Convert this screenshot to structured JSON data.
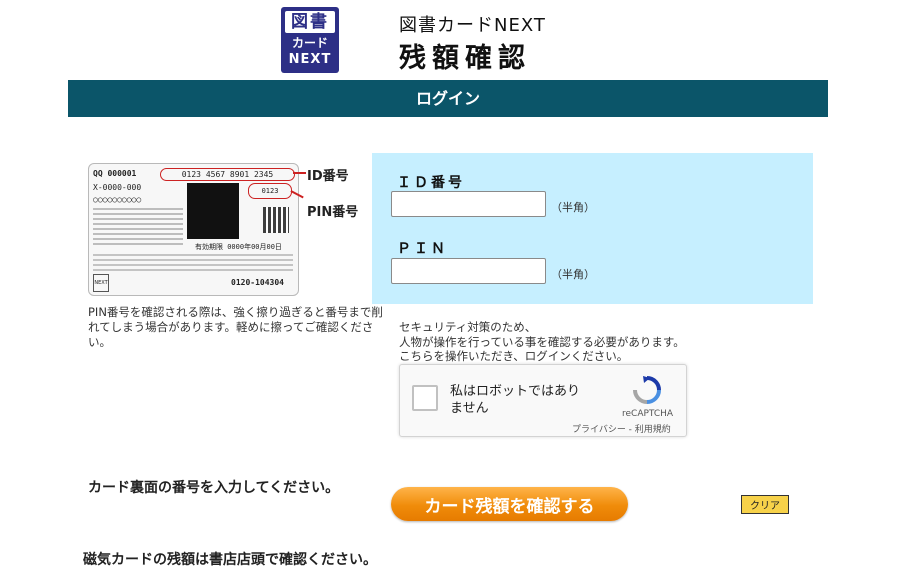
{
  "header": {
    "logo_line1": "図書",
    "logo_line2": "カード",
    "logo_line3": "NEXT",
    "brand_line1": "図書カードNEXT",
    "brand_line2": "残額確認"
  },
  "banner": {
    "title": "ログイン"
  },
  "card_image": {
    "qq_code": "QQ 000001",
    "id_number": "0123 4567 8901 2345",
    "x_code": "X-0000-000",
    "circles": "○○○○○○○○○○",
    "pin_number": "0123",
    "expiry": "有効期限 0000年00月00日",
    "phone": "0120-104304",
    "next_mark": "NEXT",
    "callout_id": "ID番号",
    "callout_pin": "PIN番号"
  },
  "card_note": "PIN番号を確認される際は、強く擦り過ぎると番号まで削れてしまう場合があります。軽めに擦ってご確認ください。",
  "form": {
    "id_label": "ＩＤ番号",
    "id_value": "",
    "id_hint": "（半角）",
    "pin_label": "ＰＩＮ",
    "pin_value": "",
    "pin_hint": "（半角）"
  },
  "security_text": {
    "line1": "セキュリティ対策のため、",
    "line2": "人物が操作を行っている事を確認する必要があります。",
    "line3": "こちらを操作いただき、ログインください。"
  },
  "recaptcha": {
    "label": "私はロボットではありません",
    "brand": "reCAPTCHA",
    "links": "プライバシー - 利用規約"
  },
  "bottom": {
    "enter_prompt": "カード裏面の番号を入力してください。",
    "confirm_button": "カード残額を確認する",
    "clear_button": "クリア",
    "magnetic_note": "磁気カードの残額は書店店頭で確認ください。"
  },
  "colors": {
    "banner": "#0b5569",
    "form_panel": "#c6efff",
    "confirm_button": "#f08c0a",
    "clear_button": "#f7d24a",
    "logo": "#2d2f86",
    "callout": "#cc2222"
  }
}
